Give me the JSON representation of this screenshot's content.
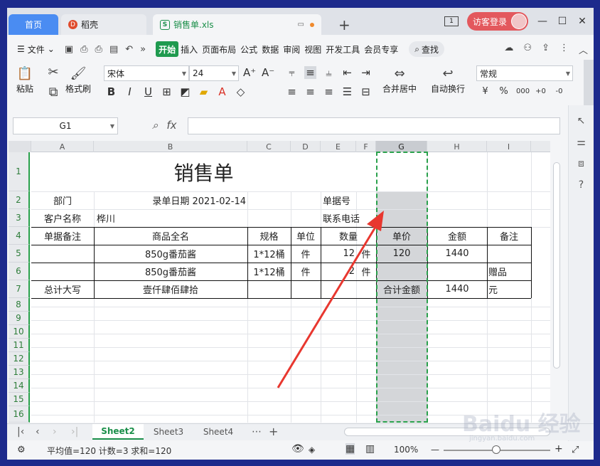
{
  "tabs": {
    "home": "首页",
    "daoke": "稻壳",
    "file": "销售单.xls",
    "guest_login": "访客登录",
    "new_tab": "+",
    "window_badge": "1"
  },
  "menu": {
    "file": "文件",
    "items": [
      "开始",
      "插入",
      "页面布局",
      "公式",
      "数据",
      "审阅",
      "视图",
      "开发工具",
      "会员专享"
    ],
    "search": "查找"
  },
  "ribbon": {
    "paste": "粘贴",
    "format_painter": "格式刷",
    "font_name": "宋体",
    "font_size": "24",
    "merge_center": "合并居中",
    "wrap_text": "自动换行",
    "number_format": "常规",
    "percent": "%",
    "thousands": "000",
    "dec_inc": "+0",
    "dec_dec": "-0"
  },
  "formula_bar": {
    "cell_ref": "G1",
    "fx": "fx",
    "value": ""
  },
  "columns": [
    "A",
    "B",
    "C",
    "D",
    "E",
    "F",
    "G",
    "H",
    "I"
  ],
  "rows": [
    "1",
    "2",
    "3",
    "4",
    "5",
    "6",
    "7",
    "8",
    "9",
    "10",
    "11",
    "12",
    "13",
    "14",
    "15",
    "16"
  ],
  "sheet": {
    "title": "销售单",
    "dept_label": "部门",
    "entry_date": "录单日期  2021-02-14",
    "doc_no_label": "单据号",
    "customer_label": "客户名称",
    "customer_name": "桦川",
    "phone_label": "联系电话",
    "headers": [
      "单据备注",
      "商品全名",
      "规格",
      "单位",
      "数量",
      "单价",
      "金额",
      "备注"
    ],
    "r5": {
      "product": "850g番茄酱",
      "spec": "1*12桶",
      "unit": "件",
      "qty": "12",
      "qty_unit": "件",
      "price": "120",
      "amount": "1440"
    },
    "r6": {
      "product": "850g番茄酱",
      "spec": "1*12桶",
      "unit": "件",
      "qty": "2",
      "qty_unit": "件",
      "note": "赠品"
    },
    "total_label": "总计大写",
    "total_caps": "壹仟肆佰肆拾",
    "sum_label": "合计金额",
    "sum_value": "1440",
    "sum_unit": "元"
  },
  "sheet_tabs": [
    "Sheet2",
    "Sheet3",
    "Sheet4"
  ],
  "status": {
    "summary": "平均值=120  计数=3  求和=120",
    "zoom": "100%"
  },
  "watermark": "Baidu 经验",
  "watermark_url": "jingyan.baidu.com",
  "annotation_color": "#e8372f",
  "accent_color": "#1f9a4f"
}
